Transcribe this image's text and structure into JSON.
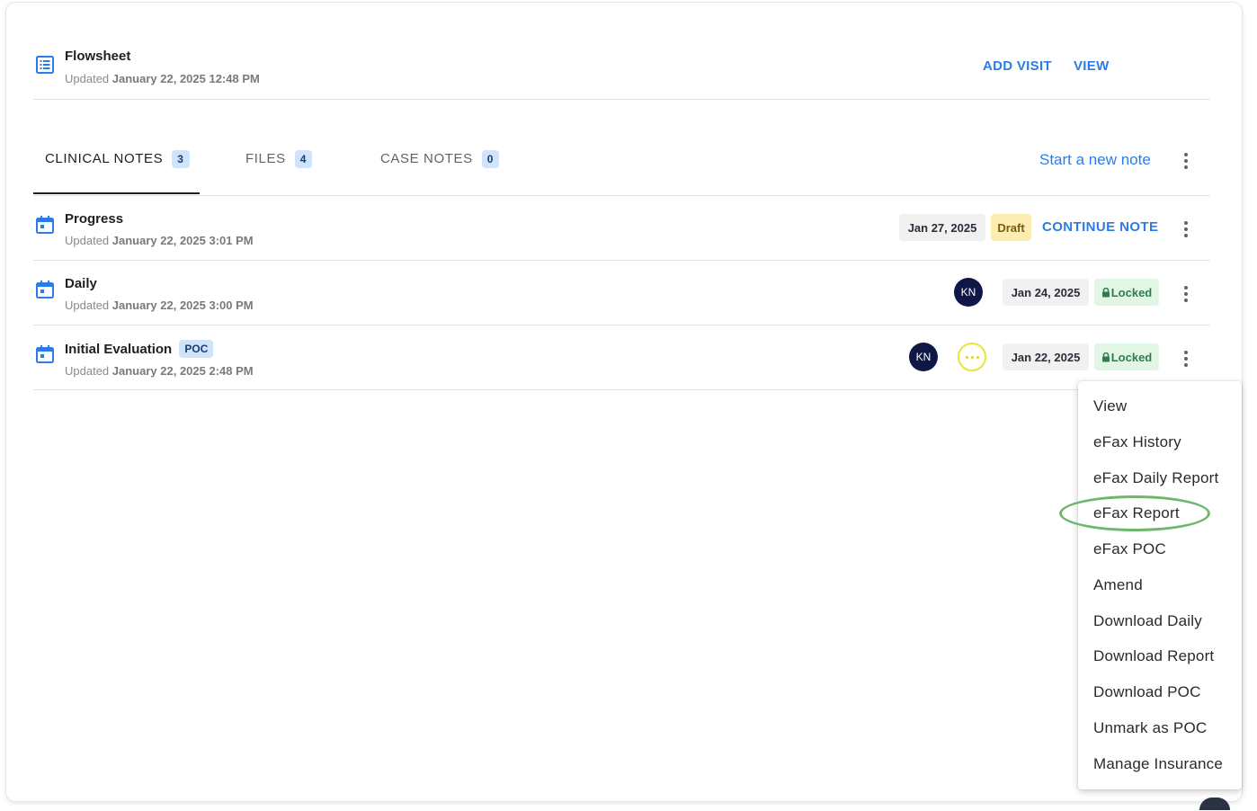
{
  "flowsheet": {
    "title": "Flowsheet",
    "updated_prefix": "Updated",
    "updated_date": "January 22, 2025 12:48 PM",
    "add_visit_label": "ADD VISIT",
    "view_label": "VIEW"
  },
  "tabs": [
    {
      "label": "CLINICAL NOTES",
      "count": "3",
      "active": true
    },
    {
      "label": "FILES",
      "count": "4",
      "active": false
    },
    {
      "label": "CASE NOTES",
      "count": "0",
      "active": false
    }
  ],
  "start_note_label": "Start a new note",
  "notes": [
    {
      "title": "Progress",
      "updated_prefix": "Updated",
      "updated_date": "January 22, 2025 3:01 PM",
      "date": "Jan 27, 2025",
      "status": "Draft",
      "action": "CONTINUE NOTE"
    },
    {
      "title": "Daily",
      "updated_prefix": "Updated",
      "updated_date": "January 22, 2025 3:00 PM",
      "avatar": "KN",
      "date": "Jan 24, 2025",
      "status": "Locked"
    },
    {
      "title": "Initial Evaluation",
      "badge": "POC",
      "updated_prefix": "Updated",
      "updated_date": "January 22, 2025 2:48 PM",
      "avatar": "KN",
      "date": "Jan 22, 2025",
      "status": "Locked"
    }
  ],
  "context_menu": {
    "items": [
      "View",
      "eFax History",
      "eFax Daily Report",
      "eFax Report",
      "eFax POC",
      "Amend",
      "Download Daily",
      "Download Report",
      "Download POC",
      "Unmark as POC",
      "Manage Insurance"
    ],
    "highlighted_item": "eFax Report"
  },
  "colors": {
    "accent": "#2b7ce9",
    "badge_bg": "#cfe3fb",
    "draft_bg": "#fbeeb0",
    "locked_bg": "#e2f6e6",
    "avatar_bg": "#0f1747",
    "highlight": "#6bb86b"
  }
}
